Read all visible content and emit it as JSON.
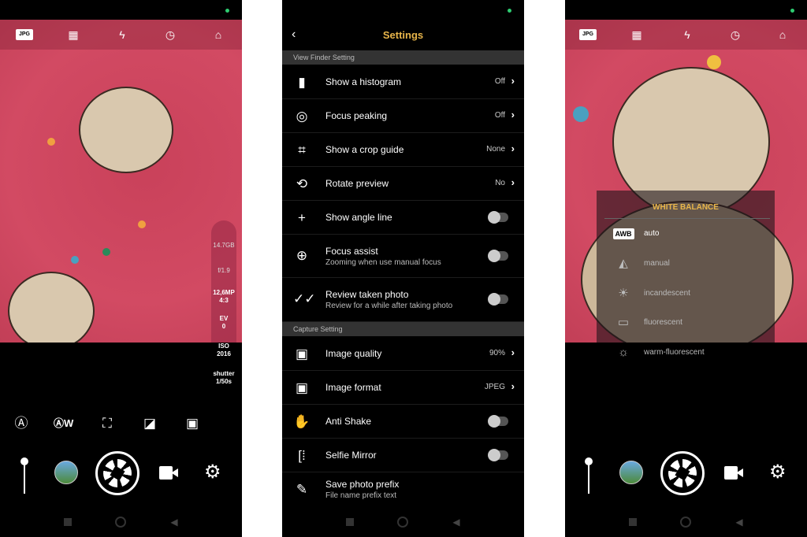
{
  "colors": {
    "accent": "#e8b54a",
    "status_dot": "#2ecc71",
    "fabric": "#d24a63"
  },
  "camera": {
    "top_icons": [
      {
        "name": "jpg-format",
        "label": "JPG"
      },
      {
        "name": "grid-off"
      },
      {
        "name": "flash-auto"
      },
      {
        "name": "timer"
      },
      {
        "name": "switch-camera"
      }
    ],
    "info": {
      "storage": "14.7GB",
      "aperture": "f/1.9",
      "resolution": "12,6MP",
      "ratio": "4:3",
      "ev_label": "EV",
      "ev": "0",
      "iso_label": "ISO",
      "iso": "2016",
      "shutter_label": "shutter",
      "shutter": "1/50s"
    },
    "mode_icons": [
      "auto-mode",
      "auto-white-balance",
      "focus-mode",
      "exposure-compensation",
      "scene-mode"
    ],
    "zoom_level": 0
  },
  "settings": {
    "title": "Settings",
    "sections": [
      {
        "title": "View Finder Setting",
        "items": [
          {
            "icon": "histogram",
            "label": "Show a histogram",
            "value": "Off"
          },
          {
            "icon": "focus-peaking",
            "label": "Focus peaking",
            "value": "Off"
          },
          {
            "icon": "crop",
            "label": "Show a crop guide",
            "value": "None"
          },
          {
            "icon": "rotate",
            "label": "Rotate preview",
            "value": "No"
          },
          {
            "icon": "angle-line",
            "label": "Show angle line",
            "toggle": false
          },
          {
            "icon": "zoom-in",
            "label": "Focus assist",
            "sub": "Zooming when use manual focus",
            "toggle": false
          },
          {
            "icon": "double-check",
            "label": "Review taken photo",
            "sub": "Review for a while after taking photo",
            "toggle": false
          }
        ]
      },
      {
        "title": "Capture Setting",
        "items": [
          {
            "icon": "image",
            "label": "Image quality",
            "value": "90%"
          },
          {
            "icon": "image",
            "label": "Image format",
            "value": "JPEG"
          },
          {
            "icon": "hand",
            "label": "Anti Shake",
            "toggle": false
          },
          {
            "icon": "mirror",
            "label": "Selfie Mirror",
            "toggle": false
          },
          {
            "icon": "pencil",
            "label": "Save photo prefix",
            "sub": "File name prefix text"
          }
        ]
      }
    ]
  },
  "white_balance": {
    "title": "WHITE BALANCE",
    "selected": "auto",
    "options": [
      {
        "icon": "awb",
        "badge": "AWB",
        "label": "auto"
      },
      {
        "icon": "manual-wb",
        "label": "manual"
      },
      {
        "icon": "bulb",
        "label": "incandescent"
      },
      {
        "icon": "fluorescent",
        "label": "fluorescent"
      },
      {
        "icon": "warm-fluorescent",
        "label": "warm-fluorescent"
      }
    ]
  }
}
